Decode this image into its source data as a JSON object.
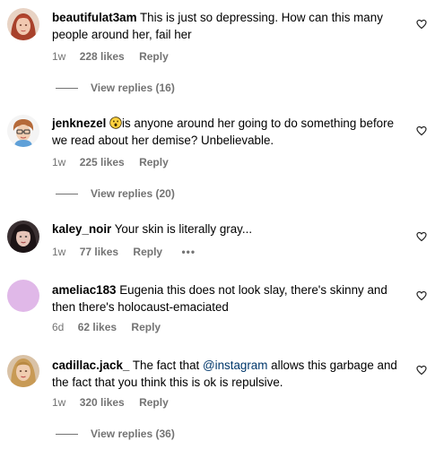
{
  "comments": [
    {
      "username": "beautifulat3am",
      "text": "This is just so depressing. How can this many people around her, fail her",
      "time": "1w",
      "likes": "228 likes",
      "reply": "Reply",
      "view_replies": "View replies (16)"
    },
    {
      "username": "jenknezel",
      "text": "is anyone around her going to do something before we read about her demise? Unbelievable.",
      "time": "1w",
      "likes": "225 likes",
      "reply": "Reply",
      "view_replies": "View replies (20)"
    },
    {
      "username": "kaley_noir",
      "text": "Your skin is literally gray...",
      "time": "1w",
      "likes": "77 likes",
      "reply": "Reply",
      "more": "•••"
    },
    {
      "username": "ameliac183",
      "text": "Eugenia this does not look slay, there's skinny and then there's holocaust-emaciated",
      "time": "6d",
      "likes": "62 likes",
      "reply": "Reply"
    },
    {
      "username": "cadillac.jack_",
      "text_before": "The fact that",
      "mention": "@instagram",
      "text_after": "allows this garbage and the fact that you think this is ok is repulsive.",
      "time": "1w",
      "likes": "320 likes",
      "reply": "Reply",
      "view_replies": "View replies (36)"
    }
  ],
  "colors": {
    "secondary_text": "#737373",
    "mention": "#00376b",
    "avatar_4_bg": "#e0b8e8"
  },
  "icons": {
    "like": "heart-outline-icon",
    "emoji": "surprised-face-emoji",
    "more": "more-horizontal-icon"
  }
}
